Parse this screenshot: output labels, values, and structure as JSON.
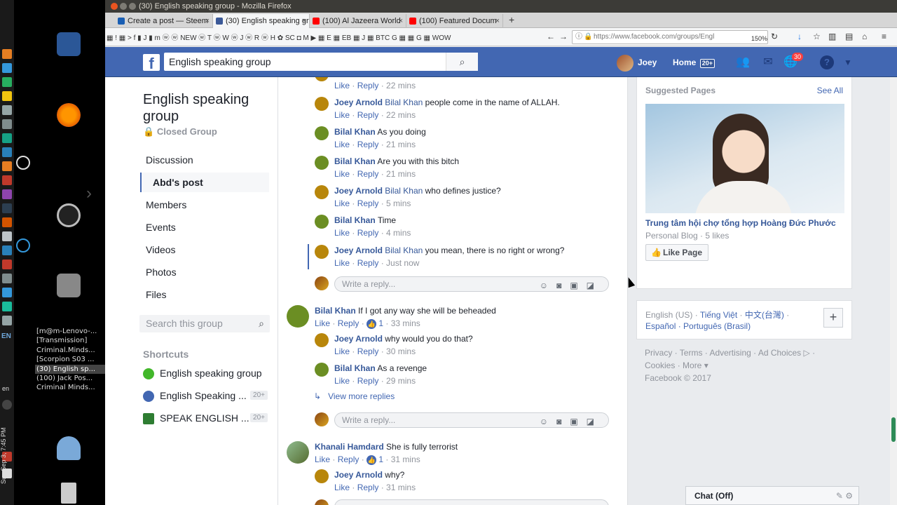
{
  "window_title": "(30) English speaking group - Mozilla Firefox",
  "tabs": [
    {
      "label": "Create a post — Steem",
      "fav": "#1a5fb4"
    },
    {
      "label": "(30) English speaking gr",
      "fav": "#3b5998"
    },
    {
      "label": "(100) Al Jazeera World",
      "fav": "#ff0000"
    },
    {
      "label": "(100) Featured Docum",
      "fav": "#ff0000"
    }
  ],
  "bookmarks_text": "▦ ! ▦ > f ▮ J ▮ m ⓦ ⓦ NEW ⓦ T ⓦ W ⓦ J ⓦ R ⓦ H ✿ SC ◘ M ▶ ▦ E ▦ EB ▦ J ▦ BTC G ▦ ▦ G ▦ WOW",
  "url": "https://www.facebook.com/groups/Engl",
  "zoom": "150%",
  "fb": {
    "search_value": "English speaking group",
    "user_name": "Joey",
    "home_label": "Home",
    "home_badge": "20+",
    "notifications_count": "30"
  },
  "group": {
    "title": "English speaking group",
    "type": "Closed Group",
    "nav": [
      "Discussion",
      "Abd's post",
      "Members",
      "Events",
      "Videos",
      "Photos",
      "Files"
    ],
    "search_placeholder": "Search this group",
    "shortcuts_title": "Shortcuts",
    "shortcuts": [
      {
        "label": "English speaking group",
        "badge": "",
        "color": "#42b72a"
      },
      {
        "label": "English Speaking ...",
        "badge": "20+",
        "color": "#4267b2"
      },
      {
        "label": "SPEAK ENGLISH ...",
        "badge": "20+",
        "color": "#2e7d32"
      }
    ]
  },
  "feed": {
    "like": "Like",
    "reply": "Reply",
    "reply_placeholder": "Write a reply...",
    "view_more": "View more replies",
    "comments": [
      {
        "name": "",
        "tag": "",
        "text": "",
        "time": "22 mins",
        "color": "#b8860b"
      },
      {
        "name": "Joey Arnold",
        "tag": "Bilal Khan",
        "text": "people come in the name of ALLAH.",
        "time": "22 mins",
        "color": "#b8860b"
      },
      {
        "name": "Bilal Khan",
        "tag": "",
        "text": "As you doing",
        "time": "21 mins",
        "color": "#6b8e23"
      },
      {
        "name": "Bilal Khan",
        "tag": "",
        "text": "Are you with this bitch",
        "time": "21 mins",
        "color": "#6b8e23"
      },
      {
        "name": "Joey Arnold",
        "tag": "Bilal Khan",
        "text": "who defines justice?",
        "time": "5 mins",
        "color": "#b8860b"
      },
      {
        "name": "Bilal Khan",
        "tag": "",
        "text": "Time",
        "time": "4 mins",
        "color": "#6b8e23"
      },
      {
        "name": "Joey Arnold",
        "tag": "Bilal Khan",
        "text": "you mean, there is no right or wrong?",
        "time": "Just now",
        "color": "#b8860b"
      }
    ],
    "comment2": {
      "name": "Bilal Khan",
      "text": "If I got any way she will be beheaded",
      "likes": "1",
      "time": "33 mins"
    },
    "replies2": [
      {
        "name": "Joey Arnold",
        "text": "why would you do that?",
        "time": "30 mins",
        "color": "#b8860b"
      },
      {
        "name": "Bilal Khan",
        "text": "As a revenge",
        "time": "29 mins",
        "color": "#6b8e23"
      }
    ],
    "comment3": {
      "name": "Khanali Hamdard",
      "text": "She is fully terrorist",
      "likes": "1",
      "time": "31 mins"
    },
    "replies3": [
      {
        "name": "Joey Arnold",
        "text": "why?",
        "time": "31 mins",
        "color": "#b8860b"
      }
    ]
  },
  "right": {
    "suggested_title": "Suggested Pages",
    "see_all": "See All",
    "page_name": "Trung tâm hội chợ tổng hợp Hoàng Đức Phước",
    "page_meta": "Personal Blog · 5 likes",
    "like_page": "Like Page",
    "lang_current": "English (US)",
    "lang_1": "Tiếng Việt",
    "lang_2": "中文(台灣)",
    "lang_3": "Español",
    "lang_4": "Português (Brasil)",
    "footer_line1": "Privacy · Terms · Advertising · Ad Choices ▷ ·",
    "footer_line2": "Cookies · More ▾",
    "footer_line3": "Facebook © 2017",
    "chat": "Chat (Off)"
  },
  "desktop": {
    "taskbar": [
      "[m@m-Lenovo-...",
      "[Transmission]",
      "Criminal.Minds...",
      "[Scorpion S03 ...",
      "(30) English sp...",
      "(100) Jack Pos...",
      "Criminal Minds..."
    ],
    "kb_layout": "EN",
    "lang": "en",
    "clock": "Sun Sep 3, 7:45 PM"
  }
}
